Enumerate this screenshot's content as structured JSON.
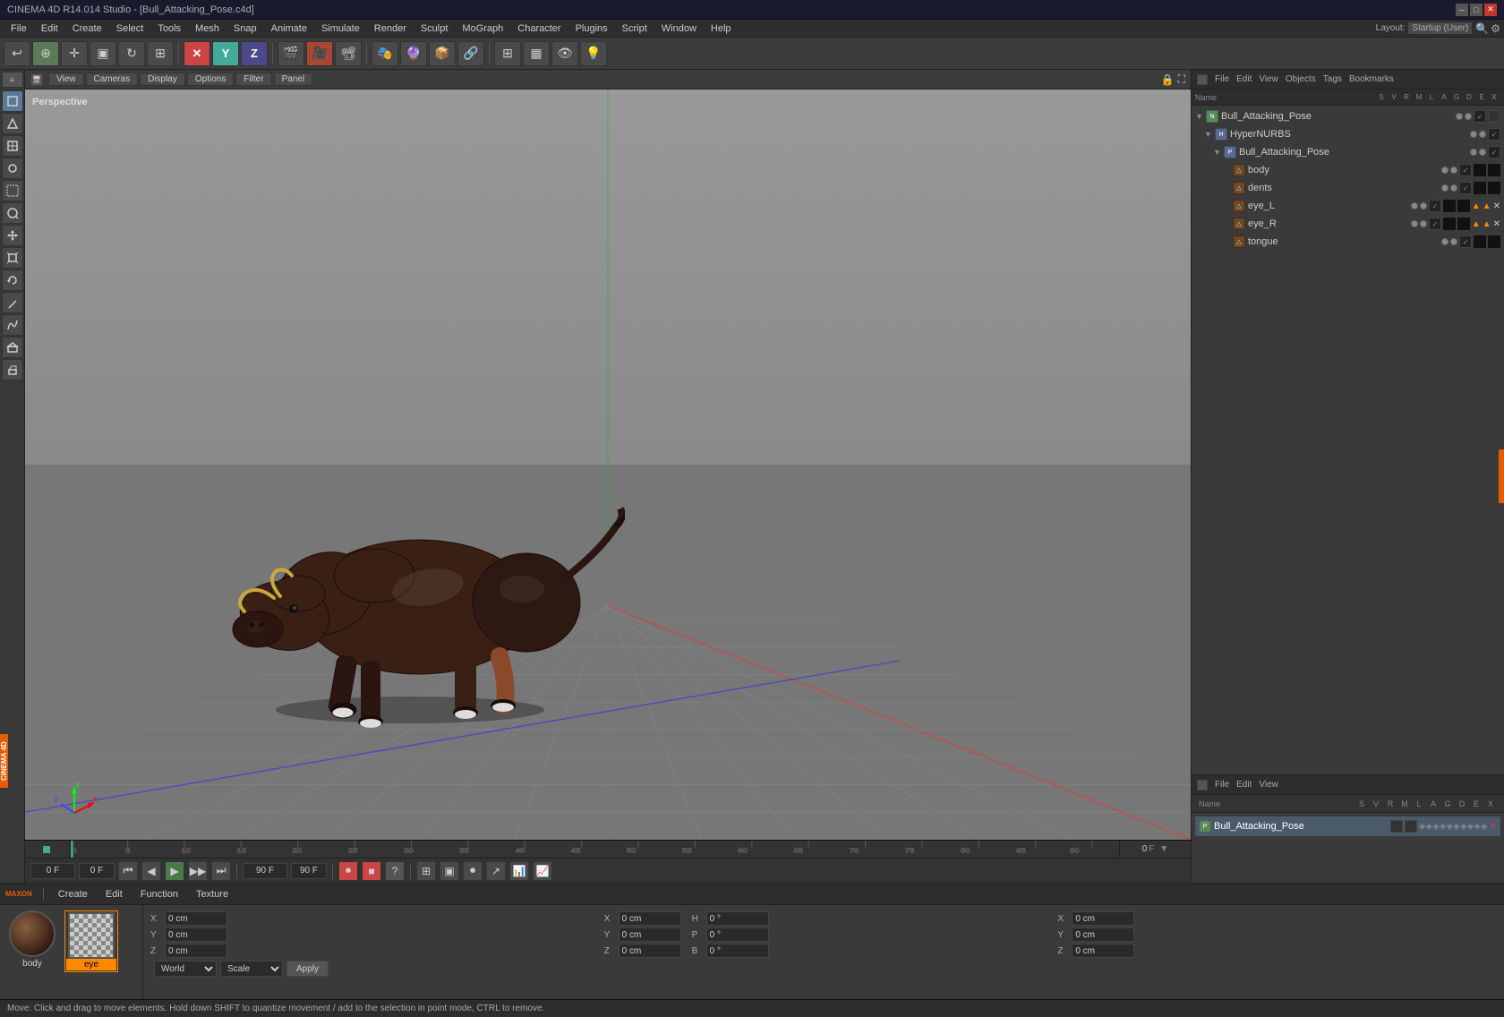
{
  "titleBar": {
    "title": "CINEMA 4D R14.014 Studio - [Bull_Attacking_Pose.c4d]",
    "buttons": {
      "minimize": "─",
      "maximize": "□",
      "close": "✕"
    }
  },
  "menuBar": {
    "items": [
      "File",
      "Edit",
      "Create",
      "Select",
      "Tools",
      "Mesh",
      "Snap",
      "Animate",
      "Simulate",
      "Render",
      "Sculpt",
      "MoGraph",
      "Character",
      "Plugins",
      "Script",
      "Window",
      "Help"
    ],
    "layout": {
      "label": "Layout:",
      "value": "Startup (User)"
    }
  },
  "viewport": {
    "perspectiveLabel": "Perspective",
    "headerTabs": [
      "View",
      "Cameras",
      "Display",
      "Options",
      "Filter",
      "Panel"
    ]
  },
  "objectManager": {
    "headerTabs": [
      "File",
      "Edit",
      "View",
      "Objects",
      "Tags",
      "Bookmarks"
    ],
    "toolbarTabs": [],
    "tree": [
      {
        "id": "bull_attacking",
        "label": "Bull_Attacking_Pose",
        "depth": 0,
        "indent": 0,
        "icon": "nurbs",
        "hasArrow": true,
        "expanded": true
      },
      {
        "id": "hyper_nurbs",
        "label": "HyperNURBS",
        "depth": 1,
        "indent": 1,
        "icon": "nurbs",
        "hasArrow": true,
        "expanded": true
      },
      {
        "id": "bull_attacking2",
        "label": "Bull_Attacking_Pose",
        "depth": 2,
        "indent": 2,
        "icon": "mesh",
        "hasArrow": true,
        "expanded": true
      },
      {
        "id": "body",
        "label": "body",
        "depth": 3,
        "indent": 3,
        "icon": "mesh"
      },
      {
        "id": "dents",
        "label": "dents",
        "depth": 3,
        "indent": 3,
        "icon": "mesh"
      },
      {
        "id": "eye_l",
        "label": "eye_L",
        "depth": 3,
        "indent": 3,
        "icon": "mesh"
      },
      {
        "id": "eye_r",
        "label": "eye_R",
        "depth": 3,
        "indent": 3,
        "icon": "mesh"
      },
      {
        "id": "tongue",
        "label": "tongue",
        "depth": 3,
        "indent": 3,
        "icon": "mesh"
      }
    ]
  },
  "attributeManager": {
    "headerTabs": [
      "File",
      "Edit",
      "View"
    ],
    "columns": {
      "name": "Name",
      "s": "S",
      "v": "V",
      "r": "R",
      "m": "M",
      "l": "L",
      "a": "A",
      "g": "G",
      "d": "D",
      "e": "E",
      "x": "X"
    },
    "selectedItem": "Bull_Attacking_Pose"
  },
  "timeline": {
    "frames": [
      "0",
      "5",
      "10",
      "15",
      "20",
      "25",
      "30",
      "35",
      "40",
      "45",
      "50",
      "55",
      "60",
      "65",
      "70",
      "75",
      "80",
      "85",
      "90"
    ],
    "currentFrame": "0",
    "totalFrames": "90",
    "startFrame": "0",
    "endFrame": "90 F"
  },
  "timelineControls": {
    "startField": "0 F",
    "frameField": "0 F",
    "endField": "90 F",
    "buttons": {
      "toStart": "⏮",
      "prev": "◀",
      "play": "▶",
      "next": "▶",
      "toEnd": "⏭",
      "record": "⏺"
    }
  },
  "materials": [
    {
      "id": "body",
      "label": "body",
      "type": "sphere"
    },
    {
      "id": "eye",
      "label": "eye",
      "type": "checker",
      "selected": true
    }
  ],
  "coordinates": {
    "labels": {
      "x": "X",
      "y": "Y",
      "z": "Z"
    },
    "position": {
      "x": "0 cm",
      "y": "0 cm",
      "z": "0 cm"
    },
    "rotation": {
      "h": "0 °",
      "p": "0 °",
      "b": "0 °"
    },
    "scale": {
      "x": "0 cm",
      "y": "0 cm",
      "z": "0 cm"
    },
    "coord1Label": "X",
    "coord2Label": "Y",
    "coord3Label": "Z",
    "systemLabel": "World",
    "scaleLabel": "Scale",
    "applyButton": "Apply"
  },
  "statusBar": {
    "message": "Move: Click and drag to move elements. Hold down SHIFT to quantize movement / add to the selection in point mode, CTRL to remove."
  },
  "bottomToolbar": {
    "tabs": [
      "Create",
      "Edit",
      "Function",
      "Texture"
    ]
  },
  "maxonBadge": "MAXON\nCINEMA 4D"
}
